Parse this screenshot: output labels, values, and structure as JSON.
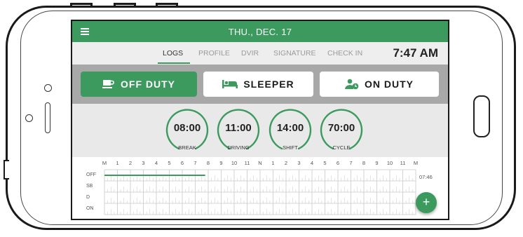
{
  "header": {
    "date": "THU., DEC. 17",
    "time": "7:47 AM"
  },
  "tabs": [
    {
      "label": "LOGS",
      "active": true
    },
    {
      "label": "PROFILE",
      "active": false
    },
    {
      "label": "DVIR",
      "active": false
    },
    {
      "label": "SIGNATURE",
      "active": false
    },
    {
      "label": "CHECK IN",
      "active": false
    }
  ],
  "duty_status": [
    {
      "label": "OFF DUTY",
      "icon": "coffee-cup-icon",
      "active": true
    },
    {
      "label": "SLEEPER",
      "icon": "bed-icon",
      "active": false
    },
    {
      "label": "ON DUTY",
      "icon": "person-clock-icon",
      "active": false
    }
  ],
  "timers": [
    {
      "value": "08:00",
      "label": "BREAK"
    },
    {
      "value": "11:00",
      "label": "DRIVING"
    },
    {
      "value": "14:00",
      "label": "SHIFT"
    },
    {
      "value": "70:00",
      "label": "CYCLE"
    }
  ],
  "log_grid": {
    "hour_labels": [
      "M",
      "1",
      "2",
      "3",
      "4",
      "5",
      "6",
      "7",
      "8",
      "9",
      "10",
      "11",
      "N",
      "1",
      "2",
      "3",
      "4",
      "5",
      "6",
      "7",
      "8",
      "9",
      "10",
      "11",
      "M"
    ],
    "rows": [
      "OFF",
      "SB",
      "D",
      "ON"
    ],
    "current_time": "07:46",
    "active_row": "OFF",
    "active_until_hour": 7.77
  },
  "fab": {
    "label": "+"
  },
  "colors": {
    "accent": "#3c9a5f",
    "duty_bar": "#a8a8a8"
  }
}
